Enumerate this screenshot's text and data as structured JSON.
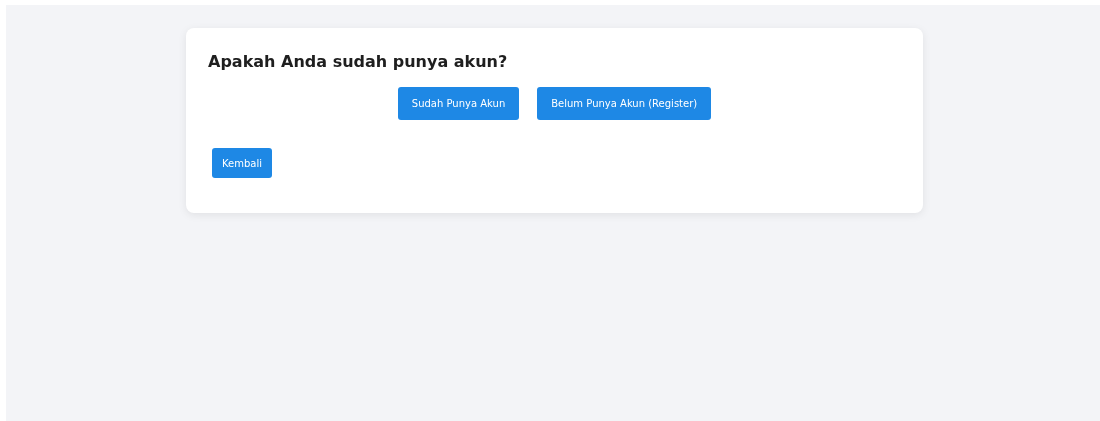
{
  "card": {
    "title": "Apakah Anda sudah punya akun?",
    "choices": [
      "Sudah Punya Akun",
      "Belum Punya Akun (Register)"
    ],
    "back_button": "Kembali"
  }
}
